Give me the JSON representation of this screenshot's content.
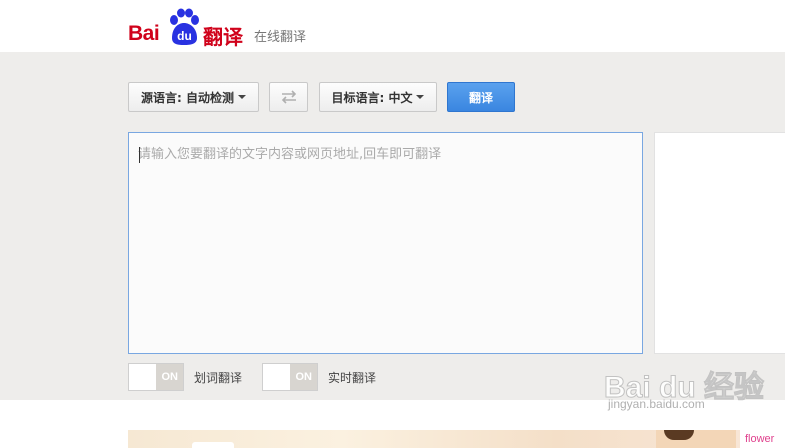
{
  "header": {
    "logo_bai": "Bai",
    "logo_du": "du",
    "logo_fanyi": "翻译",
    "subtitle": "在线翻译"
  },
  "toolbar": {
    "source_lang_label": "源语言: 自动检测",
    "swap_icon": "swap-arrows-icon",
    "target_lang_label": "目标语言: 中文",
    "translate_label": "翻译"
  },
  "input": {
    "value": "",
    "placeholder": "请输入您要翻译的文字内容或网页地址,回车即可翻译"
  },
  "options": [
    {
      "state": "ON",
      "label": "划词翻译"
    },
    {
      "state": "ON",
      "label": "实时翻译"
    }
  ],
  "banner": {
    "text": "flower"
  },
  "watermark": {
    "text": "Bai du 经验",
    "url": "jingyan.baidu.com"
  },
  "colors": {
    "brand_red": "#d0021b",
    "brand_blue": "#2932e1",
    "translate_button": "#3a86e0",
    "main_background": "#eeedeb",
    "input_border": "#79a7e1"
  }
}
